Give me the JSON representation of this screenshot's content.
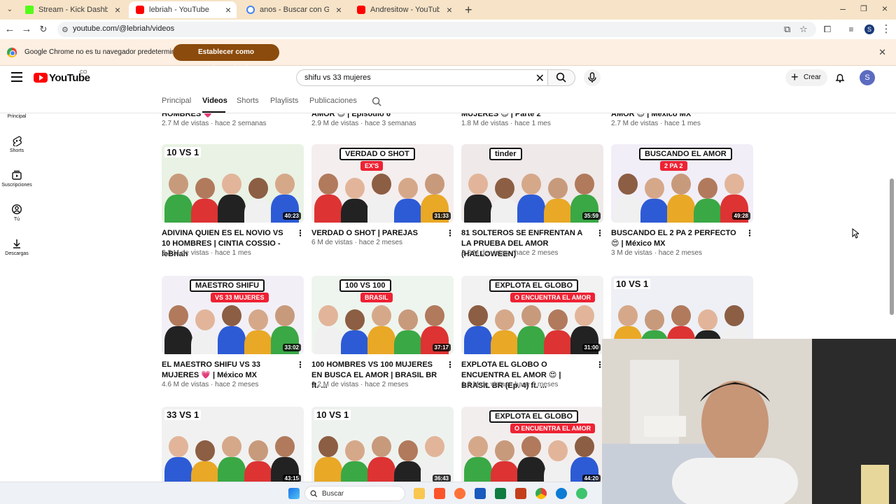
{
  "browser": {
    "tabs": [
      {
        "title": "Stream - Kick Dashboard",
        "color": "#53fc18"
      },
      {
        "title": "lebriah - YouTube",
        "color": "#ff0000"
      },
      {
        "title": "anos - Buscar con Google",
        "color": "#4285f4"
      },
      {
        "title": "Andresitow - YouTube",
        "color": "#ff0000"
      }
    ],
    "url": "youtube.com/@lebriah/videos",
    "profile_initial": "S",
    "infobar": {
      "text": "Google Chrome no es tu navegador predeterminado",
      "button": "Establecer como predeterminado"
    }
  },
  "youtube": {
    "logo_text": "YouTube",
    "country_code": "CO",
    "search_query": "shifu vs 33 mujeres",
    "create_label": "Crear",
    "avatar_initial": "S",
    "sidenav": [
      "Principal",
      "Shorts",
      "Suscripciones",
      "Tú",
      "Descargas"
    ],
    "channel_tabs": [
      "Principal",
      "Videos",
      "Shorts",
      "Playlists",
      "Publicaciones"
    ],
    "active_tab": "Videos"
  },
  "partial_row": [
    {
      "title_tail": "HOMBRES 💗",
      "meta": "2.7 M de vistas · hace 2 semanas"
    },
    {
      "title_tail": "AMOR 😍 | Episodio 6",
      "meta": "2.9 M de vistas · hace 3 semanas"
    },
    {
      "title_tail": "MUJERES 😍 | Parte 2",
      "meta": "1.8 M de vistas · hace 1 mes"
    },
    {
      "title_tail": "AMOR 😍 | México MX",
      "meta": "2.7 M de vistas · hace 1 mes"
    }
  ],
  "rows": [
    [
      {
        "duration": "40:23",
        "title": "ADIVINA QUIEN ES EL NOVIO VS 10 HOMBRES | CINTIA COSSIO - leBriah",
        "meta": "3.3 M de vistas · hace 1 mes",
        "banner": "10 VS 1",
        "bg": "#e9f2e4"
      },
      {
        "duration": "31:33",
        "title": "VERDAD O SHOT | PAREJAS",
        "meta": "6 M de vistas · hace 2 meses",
        "banner": "VERDAD O SHOT",
        "banner2": "EX'S",
        "bg": "#f5eeee"
      },
      {
        "duration": "35:59",
        "title": "81 SOLTEROS SE ENFRENTAN A LA PRUEBA DEL AMOR (HALLOWEEN)",
        "meta": "2.2 M de vistas · hace 2 meses",
        "banner": "tinder",
        "bg": "#efe9e9"
      },
      {
        "duration": "49:28",
        "title": "BUSCANDO EL 2 PA 2 PERFECTO 😍 | México MX",
        "meta": "3 M de vistas · hace 2 meses",
        "banner": "BUSCANDO EL AMOR",
        "banner2": "2 PA 2",
        "bg": "#f1eef8"
      }
    ],
    [
      {
        "duration": "33:02",
        "title": "EL MAESTRO SHIFU VS 33 MUJERES 💗 | México MX",
        "meta": "4.6 M de vistas · hace 2 meses",
        "banner": "MAESTRO SHIFU",
        "banner2": "VS 33 MUJERES",
        "bg": "#f2f0f6"
      },
      {
        "duration": "37:17",
        "title": "100 HOMBRES VS 100 MUJERES EN BUSCA EL AMOR | BRASIL BR ft. ...",
        "meta": "2.2 M de vistas · hace 2 meses",
        "banner": "100 VS 100",
        "banner2": "BRASIL",
        "bg": "#eef5ee"
      },
      {
        "duration": "31:00",
        "title": "EXPLOTA EL GLOBO O ENCUENTRA EL AMOR 😍 | BRASIL BR (Ep. 4) ft. ...",
        "meta": "1.8 M de vistas · hace 3 meses",
        "banner": "EXPLOTA EL GLOBO",
        "banner2": "O ENCUENTRA EL AMOR",
        "bg": "#f2f2f2"
      },
      {
        "duration": "",
        "title": "",
        "meta": "",
        "banner": "10 VS 1",
        "bg": "#eef0f5"
      }
    ],
    [
      {
        "duration": "43:15",
        "title": "",
        "meta": "",
        "banner": "33 VS 1",
        "bg": "#f1f1f1"
      },
      {
        "duration": "36:43",
        "title": "",
        "meta": "",
        "banner": "10 VS 1",
        "bg": "#eef2ee"
      },
      {
        "duration": "44:20",
        "title": "",
        "meta": "",
        "banner": "EXPLOTA EL GLOBO",
        "banner2": "O ENCUENTRA EL AMOR",
        "bg": "#f3eeee"
      }
    ]
  ],
  "taskbar": {
    "search_label": "Buscar"
  }
}
